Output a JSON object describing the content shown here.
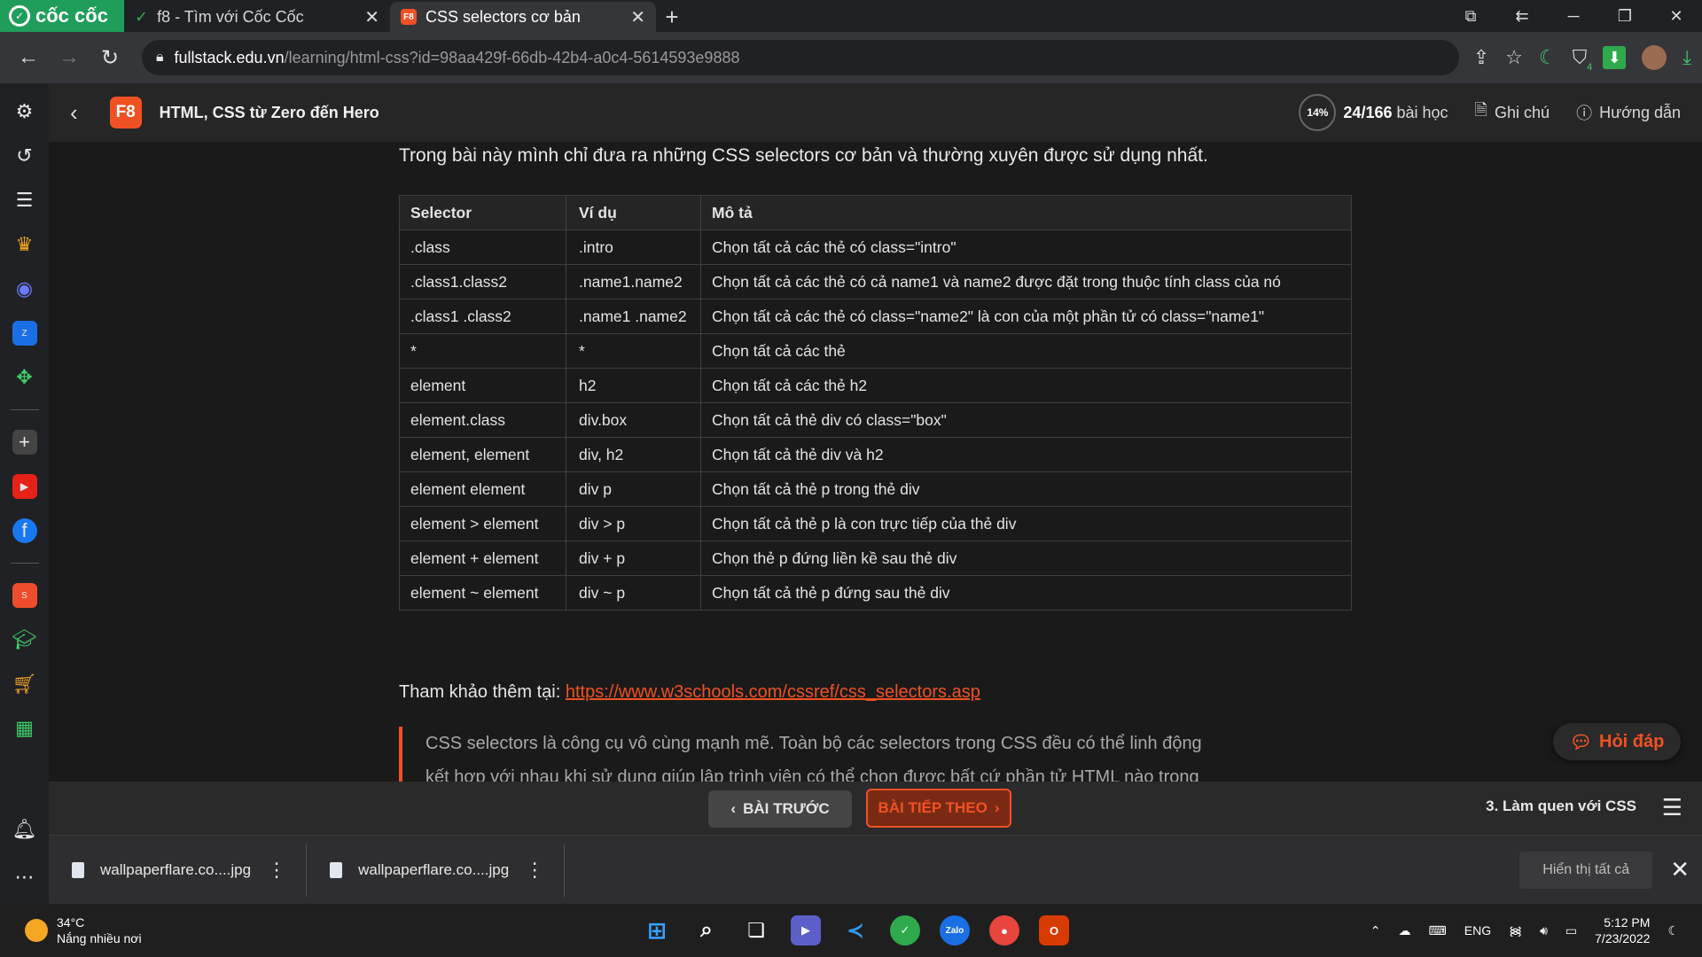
{
  "browser": {
    "brand": "cốc cốc",
    "tabs": [
      {
        "title": "f8 - Tìm với Cốc Cốc",
        "active": false,
        "icon": "coccoc-icon"
      },
      {
        "title": "CSS selectors cơ bản",
        "active": true,
        "icon": "f8-icon"
      }
    ],
    "url_host": "fullstack.edu.vn",
    "url_path": "/learning/html-css?id=98aa429f-66db-42b4-a0c4-5614593e9888",
    "extension_badge": "4"
  },
  "header": {
    "logo": "F8",
    "course_title": "HTML, CSS từ Zero đến Hero",
    "progress_percent": "14%",
    "lesson_done": "24/166",
    "lesson_suffix": "bài học",
    "notes_label": "Ghi chú",
    "guide_label": "Hướng dẫn"
  },
  "article": {
    "intro": "Trong bài này mình chỉ đưa ra những CSS selectors cơ bản và thường xuyên được sử dụng nhất.",
    "table_headers": [
      "Selector",
      "Ví dụ",
      "Mô tả"
    ],
    "rows": [
      [
        ".class",
        ".intro",
        "Chọn tất cả các thẻ có class=\"intro\""
      ],
      [
        ".class1.class2",
        ".name1.name2",
        "Chọn tất cả các thẻ có cả name1 và name2 được đặt trong thuộc tính class của nó"
      ],
      [
        ".class1 .class2",
        ".name1 .name2",
        "Chọn tất cả các thẻ có class=\"name2\" là con của một phần tử có class=\"name1\""
      ],
      [
        "*",
        "*",
        "Chọn tất cả các thẻ"
      ],
      [
        "element",
        "h2",
        "Chọn tất cả các thẻ h2"
      ],
      [
        "element.class",
        "div.box",
        "Chọn tất cả thẻ div có class=\"box\""
      ],
      [
        "element, element",
        "div, h2",
        "Chọn tất cả thẻ div và h2"
      ],
      [
        "element element",
        "div p",
        "Chọn tất cả thẻ p trong thẻ div"
      ],
      [
        "element > element",
        "div > p",
        "Chọn tất cả thẻ p là con trực tiếp của thẻ div"
      ],
      [
        "element + element",
        "div + p",
        "Chọn thẻ p đứng liền kề sau thẻ div"
      ],
      [
        "element ~ element",
        "div ~ p",
        "Chọn tất cả thẻ p đứng sau thẻ div"
      ]
    ],
    "ref_label": "Tham khảo thêm tại:",
    "ref_link": "https://www.w3schools.com/cssref/css_selectors.asp",
    "quote_line1": "CSS selectors là công cụ vô cùng mạnh mẽ. Toàn bộ các selectors trong CSS đều có thể linh động",
    "quote_line2": "kết hợp với nhau khi sử dụng giúp lập trình viên có thể chọn được bất cứ phần tử HTML nào trong"
  },
  "qa_button": "Hỏi đáp",
  "lesson_nav": {
    "prev": "BÀI TRƯỚC",
    "next": "BÀI TIẾP THEO",
    "chapter": "3. Làm quen với CSS"
  },
  "downloads": {
    "items": [
      "wallpaperflare.co....jpg",
      "wallpaperflare.co....jpg"
    ],
    "show_all": "Hiển thị tất cả"
  },
  "taskbar": {
    "temp": "34°C",
    "weather": "Nắng nhiều nơi",
    "lang": "ENG",
    "time": "5:12 PM",
    "date": "7/23/2022"
  }
}
